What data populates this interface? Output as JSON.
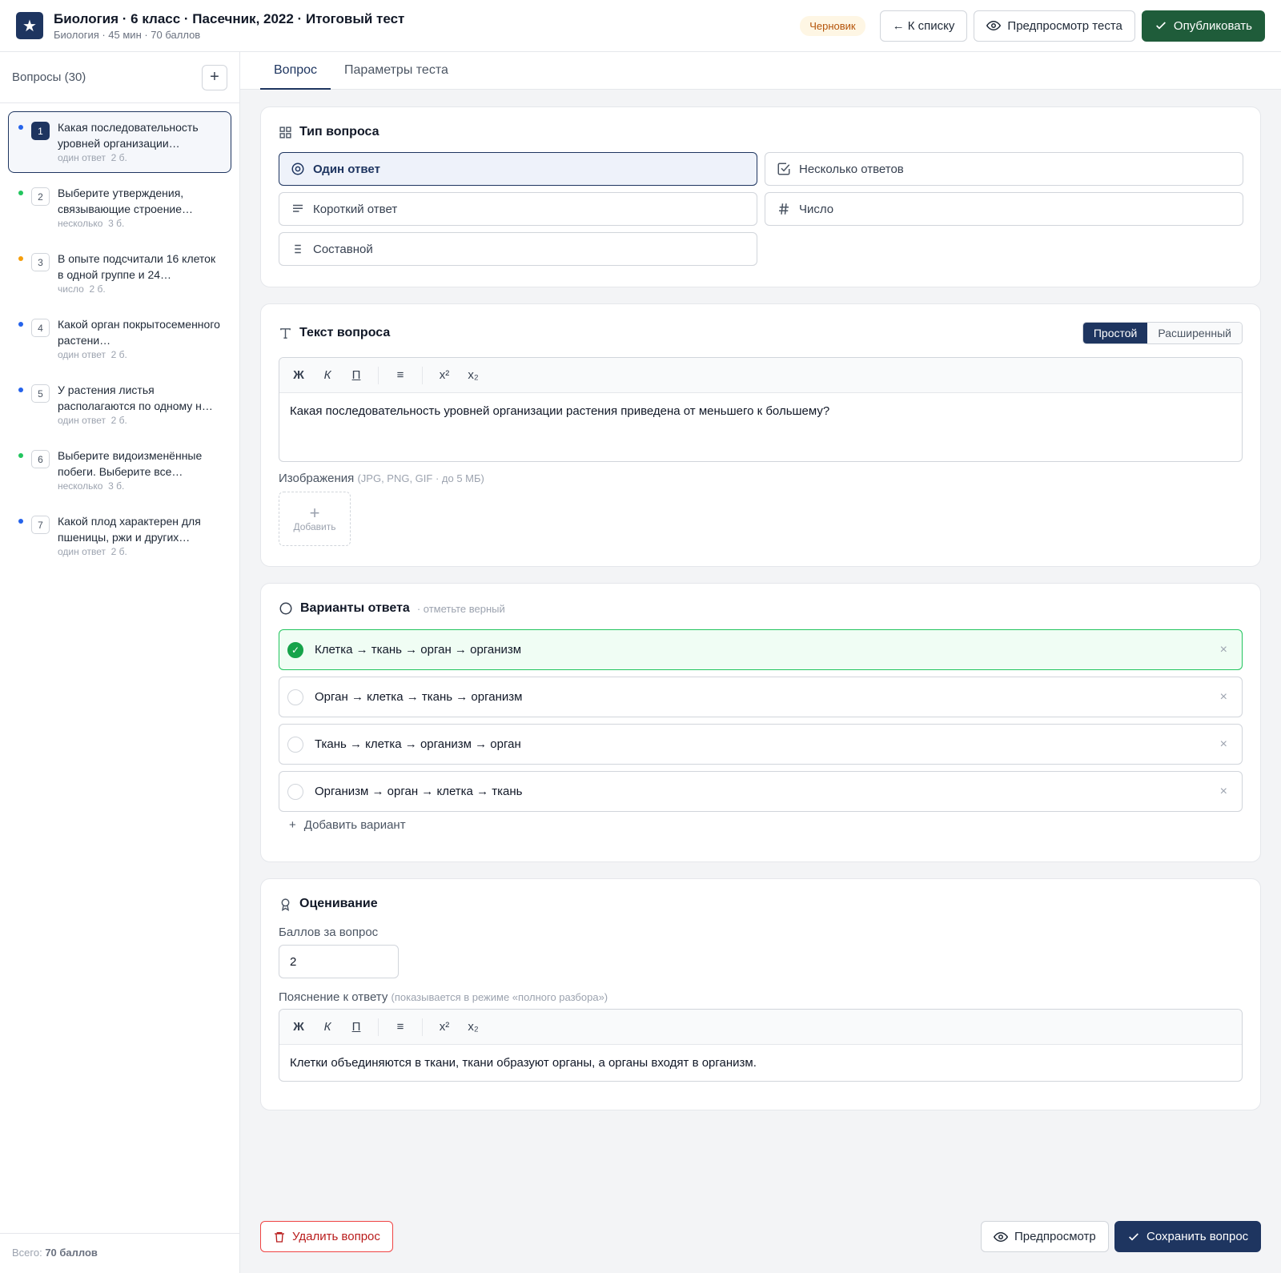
{
  "header": {
    "logo_glyph": "★",
    "title": "Биология · 6 класс · Пасечник, 2022 · Итоговый тест",
    "subtitle": "Биология · 45 мин · 70 баллов",
    "status_badge": "Черновик",
    "back_label": "← К списку",
    "preview_label": "Предпросмотр теста",
    "publish_label": "Опубликовать"
  },
  "sidebar": {
    "title": "Вопросы (30)",
    "add_label": "+",
    "footer_prefix": "Всего: ",
    "footer_value": "70 баллов",
    "items": [
      {
        "num": "1",
        "text": "Какая последовательность уровней организации…",
        "type": "один ответ",
        "points": "2 б.",
        "dot": "#2563eb"
      },
      {
        "num": "2",
        "text": "Выберите утверждения, связывающие строение…",
        "type": "несколько",
        "points": "3 б.",
        "dot": "#22c55e"
      },
      {
        "num": "3",
        "text": "В опыте подсчитали 16 клеток в одной группе и 24…",
        "type": "число",
        "points": "2 б.",
        "dot": "#f59e0b"
      },
      {
        "num": "4",
        "text": "Какой орган покрытосеменного растени…",
        "type": "один ответ",
        "points": "2 б.",
        "dot": "#2563eb"
      },
      {
        "num": "5",
        "text": "У растения листья располагаются по одному н…",
        "type": "один ответ",
        "points": "2 б.",
        "dot": "#2563eb"
      },
      {
        "num": "6",
        "text": "Выберите видоизменённые побеги. Выберите все…",
        "type": "несколько",
        "points": "3 б.",
        "dot": "#22c55e"
      },
      {
        "num": "7",
        "text": "Какой плод характерен для пшеницы, ржи и других…",
        "type": "один ответ",
        "points": "2 б.",
        "dot": "#2563eb"
      }
    ]
  },
  "tabs": {
    "question": "Вопрос",
    "params": "Параметры теста"
  },
  "type_card": {
    "title": "Тип вопроса",
    "options": {
      "single": "Один ответ",
      "multiple": "Несколько ответов",
      "short": "Короткий ответ",
      "number": "Число",
      "compound": "Составной"
    }
  },
  "text_card": {
    "title": "Текст вопроса",
    "mode_simple": "Простой",
    "mode_advanced": "Расширенный",
    "toolbar": {
      "bold": "Ж",
      "italic": "К",
      "underline": "П",
      "list": "≡",
      "sup": "x²",
      "sub": "x₂"
    },
    "body": "Какая последовательность уровней организации растения приведена от меньшего к большему?",
    "images_label": "Изображения",
    "images_hint": "(JPG, PNG, GIF · до 5 МБ)",
    "upload_plus": "+",
    "upload_label": "Добавить"
  },
  "answers_card": {
    "title": "Варианты ответа",
    "hint": "· отметьте верный",
    "options": [
      "Клетка → ткань → орган → организм",
      "Орган → клетка → ткань → организм",
      "Ткань → клетка → организм → орган",
      "Организм → орган → клетка → ткань"
    ],
    "add_label": "Добавить вариант"
  },
  "grading_card": {
    "title": "Оценивание",
    "points_label": "Баллов за вопрос",
    "points_value": "2",
    "explain_label": "Пояснение к ответу",
    "explain_hint": "(показывается в режиме «полного разбора»)",
    "explain_body": "Клетки объединяются в ткани, ткани образуют органы, а органы входят в организм."
  },
  "footer": {
    "delete_label": "Удалить вопрос",
    "preview_label": "Предпросмотр",
    "save_label": "Сохранить вопрос"
  },
  "colors": {
    "accent": "#1e3560",
    "publish": "#1f5c3a",
    "correct": "#16a34a",
    "danger": "#b91c1c"
  }
}
